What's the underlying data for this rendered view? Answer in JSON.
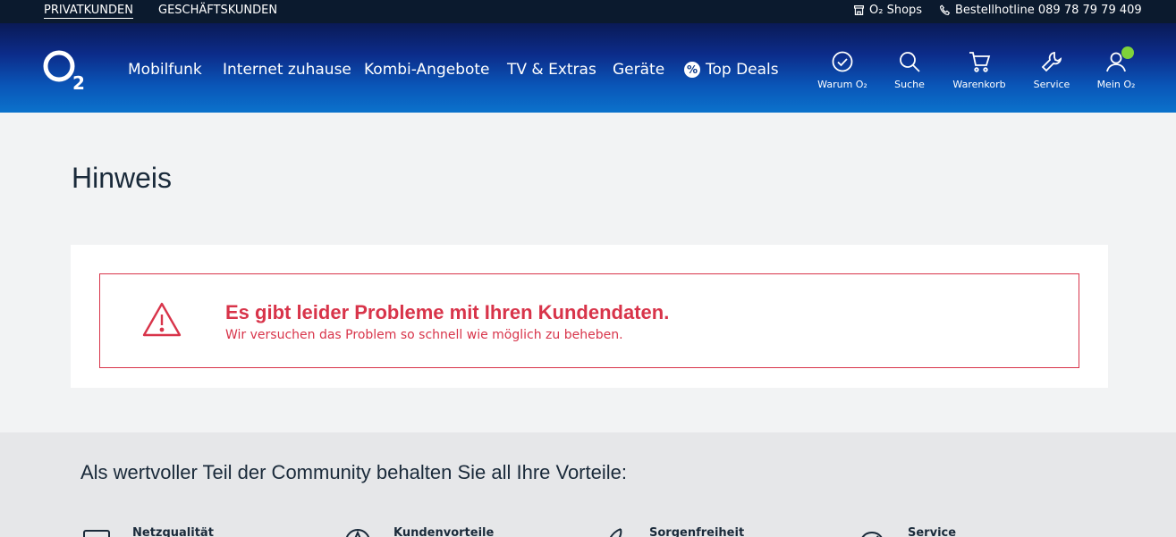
{
  "topbar": {
    "segments": [
      {
        "label": "PRIVATKUNDEN",
        "active": true
      },
      {
        "label": "GESCHÄFTSKUNDEN",
        "active": false
      }
    ],
    "shops_label": "O₂ Shops",
    "hotline_label": "Bestellhotline 089 78 79 79 409"
  },
  "nav": {
    "logo_text": "O₂",
    "items": [
      {
        "label": "Mobilfunk"
      },
      {
        "label": "Internet zuhause"
      },
      {
        "label": "Kombi-Angebote"
      },
      {
        "label": "TV & Extras"
      },
      {
        "label": "Geräte"
      },
      {
        "label": "Top Deals",
        "icon": "percent-badge-icon"
      }
    ],
    "icons": [
      {
        "label": "Warum O₂",
        "icon": "check-circle-icon"
      },
      {
        "label": "Suche",
        "icon": "search-icon"
      },
      {
        "label": "Warenkorb",
        "icon": "cart-icon"
      },
      {
        "label": "Service",
        "icon": "wrench-icon"
      },
      {
        "label": "Mein O₂",
        "icon": "user-icon",
        "status": "logged-in"
      }
    ]
  },
  "main": {
    "title": "Hinweis",
    "alert": {
      "icon": "warning-triangle-icon",
      "title": "Es gibt leider Probleme mit Ihren Kundendaten.",
      "message": "Wir versuchen das Problem so schnell wie möglich zu beheben."
    }
  },
  "community": {
    "title": "Als wertvoller Teil der Community behalten Sie all Ihre Vorteile:",
    "benefits": [
      {
        "label": "Netzqualität",
        "icon": "network-icon"
      },
      {
        "label": "Kundenvorteile",
        "icon": "star-icon"
      },
      {
        "label": "Sorgenfreiheit",
        "icon": "feather-icon"
      },
      {
        "label": "Service",
        "icon": "gauge-icon"
      }
    ]
  },
  "colors": {
    "error": "#d8344a",
    "nav_top": "#0a1a56",
    "nav_bottom": "#0b72cc",
    "status_green": "#7fd33a"
  }
}
